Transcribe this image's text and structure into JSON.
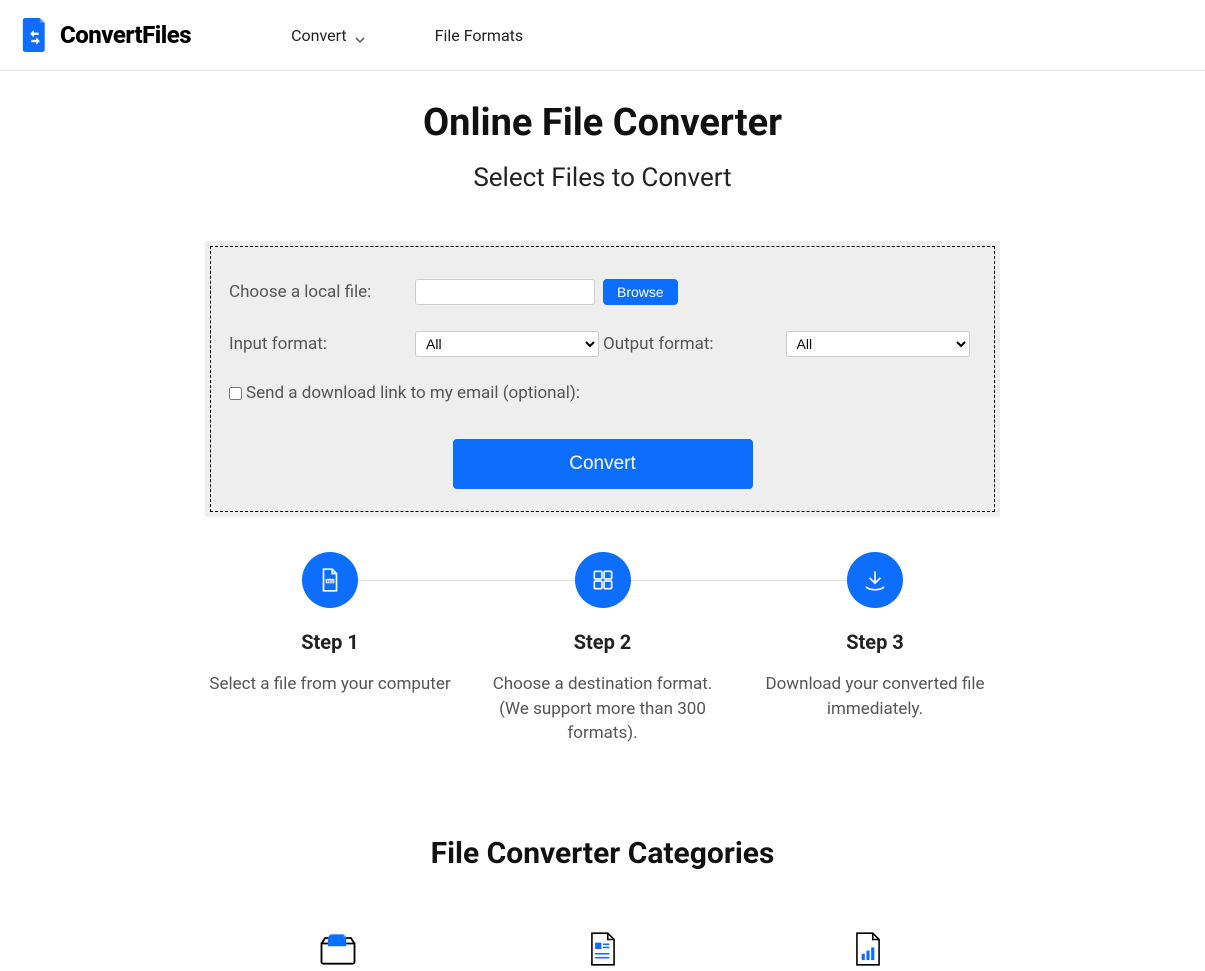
{
  "header": {
    "brand": "ConvertFiles",
    "nav": {
      "convert": "Convert",
      "file_formats": "File Formats"
    }
  },
  "main": {
    "title": "Online File Converter",
    "subtitle": "Select Files to Convert"
  },
  "form": {
    "choose_label": "Choose a local file:",
    "file_value": "",
    "browse_label": "Browse",
    "input_format_label": "Input format:",
    "input_format_value": "All",
    "output_format_label": "Output format:",
    "output_format_value": "All",
    "email_checkbox_label": "Send a download link to my email (optional):",
    "convert_label": "Convert"
  },
  "steps": [
    {
      "title": "Step 1",
      "desc": "Select a file from your computer"
    },
    {
      "title": "Step 2",
      "desc": "Choose a destination format. (We support more than 300 formats)."
    },
    {
      "title": "Step 3",
      "desc": "Download your converted file immediately."
    }
  ],
  "categories": {
    "title": "File Converter Categories"
  }
}
